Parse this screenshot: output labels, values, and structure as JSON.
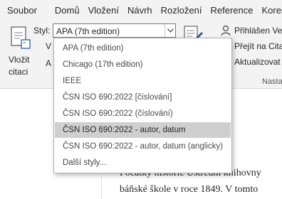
{
  "menubar": {
    "tabs": [
      {
        "label": "Soubor"
      },
      {
        "label": "Domů"
      },
      {
        "label": "Vložení"
      },
      {
        "label": "Návrh"
      },
      {
        "label": "Rozložení"
      },
      {
        "label": "Reference"
      },
      {
        "label": "Koresp"
      }
    ]
  },
  "ribbon": {
    "insert_citation": {
      "line1": "Vložit",
      "line2": "citaci",
      "icon": "insert-citation-icon"
    },
    "style": {
      "label": "Styl:",
      "value": "APA (7th edition)"
    },
    "peek_row1": "V",
    "peek_row2": "A",
    "right_rows": [
      {
        "label": "Přihlášen Ver",
        "icon": "person-icon"
      },
      {
        "label": "Přejít na Citac",
        "icon": "link-icon"
      },
      {
        "label": "Aktualizovat",
        "icon": "refresh-icon"
      }
    ],
    "group_label": "Nasta"
  },
  "dropdown": {
    "items": [
      {
        "label": "APA (7th edition)"
      },
      {
        "label": "Chicago (17th edition)"
      },
      {
        "label": "IEEE"
      },
      {
        "label": "ČSN ISO 690:2022 [číslování]"
      },
      {
        "label": "ČSN ISO 690:2022 (číslování)"
      },
      {
        "label": "ČSN ISO 690:2022 - autor, datum"
      },
      {
        "label": "ČSN ISO 690:2022 - autor, datum (anglicky)"
      },
      {
        "label": "Další styly..."
      }
    ],
    "selected_index": 5
  },
  "document": {
    "line1": "Počátky historie Ústřední knihovny",
    "line2": "báňské škole v roce 1849. V tomto"
  },
  "colors": {
    "accent": "#2b579a",
    "highlight": "#cfcfcf",
    "chrome": "#f3f3f3"
  }
}
